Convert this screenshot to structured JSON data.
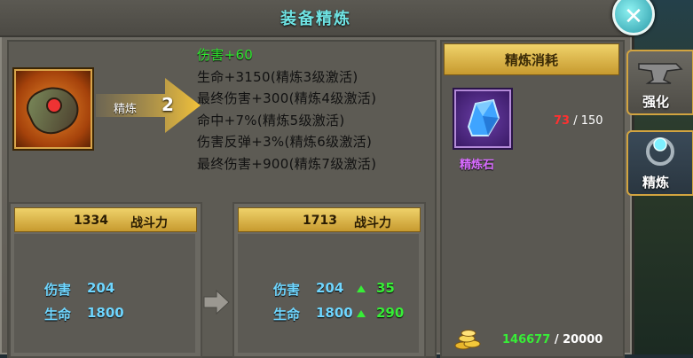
{
  "window": {
    "title": "装备精炼"
  },
  "refine": {
    "arrow_label": "精炼",
    "level": "2",
    "bonuses": [
      "伤害+60",
      "生命+3150(精炼3级激活)",
      "最终伤害+300(精炼4级激活)",
      "命中+7%(精炼5级激活)",
      "伤害反弹+3%(精炼6级激活)",
      "最终伤害+900(精炼7级激活)"
    ]
  },
  "before": {
    "power": "1334",
    "power_label": "战斗力",
    "stats": [
      {
        "name": "伤害",
        "value": "204"
      },
      {
        "name": "生命",
        "value": "1800"
      }
    ]
  },
  "after": {
    "power": "1713",
    "power_label": "战斗力",
    "stats": [
      {
        "name": "伤害",
        "value": "204",
        "increase": "35"
      },
      {
        "name": "生命",
        "value": "1800",
        "increase": "290"
      }
    ]
  },
  "cost": {
    "header": "精炼消耗",
    "material": {
      "name": "精炼石",
      "have": "73",
      "need": "/ 150",
      "icon": "refining-stone-icon"
    },
    "gold": {
      "have": "146677",
      "need": "/ 20000",
      "icon": "gold-coins-icon"
    }
  },
  "side_tabs": [
    {
      "label": "强化",
      "icon": "anvil-icon"
    },
    {
      "label": "精炼",
      "icon": "refine-orb-icon"
    }
  ],
  "colors": {
    "accent_gold": "#efd26a",
    "stat_blue": "#6fd6ff",
    "increase_green": "#37ee37",
    "title_cyan": "#6fe3e3",
    "shortage_red": "#ff3030"
  }
}
